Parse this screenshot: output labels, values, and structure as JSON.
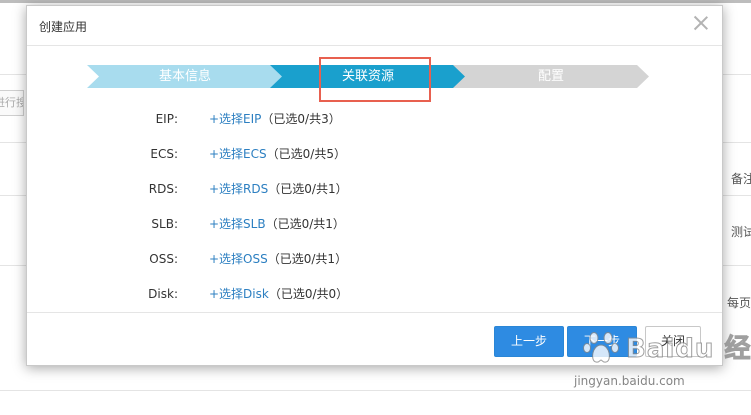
{
  "background": {
    "search_stub": "进行搜",
    "right_texts": [
      "备注",
      "测试",
      "每页"
    ]
  },
  "modal": {
    "title": "创建应用",
    "steps": [
      {
        "label": "基本信息",
        "state": "done"
      },
      {
        "label": "关联资源",
        "state": "active"
      },
      {
        "label": "配置",
        "state": "pending"
      }
    ],
    "rows": [
      {
        "label": "EIP:",
        "link": "+选择EIP",
        "count": "（已选0/共3）"
      },
      {
        "label": "ECS:",
        "link": "+选择ECS",
        "count": "（已选0/共5）"
      },
      {
        "label": "RDS:",
        "link": "+选择RDS",
        "count": "（已选0/共1）"
      },
      {
        "label": "SLB:",
        "link": "+选择SLB",
        "count": "（已选0/共1）"
      },
      {
        "label": "OSS:",
        "link": "+选择OSS",
        "count": "（已选0/共1）"
      },
      {
        "label": "Disk:",
        "link": "+选择Disk",
        "count": "（已选0/共0）"
      }
    ],
    "buttons": {
      "prev": "上一步",
      "next": "下一步",
      "close": "关闭"
    }
  },
  "watermark": {
    "brand": "Baidu 经验",
    "url": "jingyan.baidu.com"
  },
  "colors": {
    "step_done": "#a8dcee",
    "step_active": "#1aa0cd",
    "step_pending": "#d4d4d4",
    "primary_button": "#2e8be2",
    "link": "#2c7fc1",
    "highlight": "#e8604f"
  }
}
